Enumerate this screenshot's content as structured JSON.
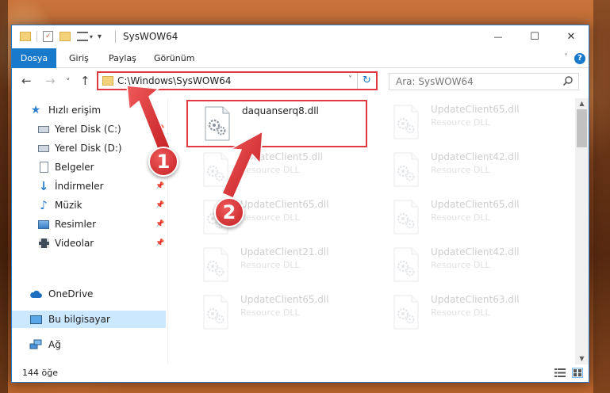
{
  "window": {
    "title": "SysWOW64",
    "minimize_glyph": "—",
    "maximize_glyph": "☐",
    "close_glyph": "✕"
  },
  "ribbon": {
    "tabs": [
      "Dosya",
      "Giriş",
      "Paylaş",
      "Görünüm"
    ],
    "help_glyph": "?"
  },
  "nav": {
    "back_glyph": "←",
    "forward_glyph": "→",
    "recent_glyph": "˅",
    "up_glyph": "↑"
  },
  "address": {
    "path": "C:\\Windows\\SysWOW64"
  },
  "search": {
    "placeholder": "Ara: SysWOW64"
  },
  "sidebar": {
    "items": [
      {
        "label": "Hızlı erişim",
        "icon": "star-icon"
      },
      {
        "label": "Yerel Disk (C:)",
        "icon": "drive-icon",
        "pinned": true
      },
      {
        "label": "Yerel Disk (D:)",
        "icon": "drive-icon",
        "pinned": true
      },
      {
        "label": "Belgeler",
        "icon": "documents-icon",
        "pinned": true
      },
      {
        "label": "İndirmeler",
        "icon": "downloads-icon",
        "pinned": true
      },
      {
        "label": "Müzik",
        "icon": "music-icon",
        "pinned": true
      },
      {
        "label": "Resimler",
        "icon": "pictures-icon",
        "pinned": true
      },
      {
        "label": "Videolar",
        "icon": "videos-icon",
        "pinned": true
      },
      {
        "label": "OneDrive",
        "icon": "cloud-icon"
      },
      {
        "label": "Bu bilgisayar",
        "icon": "computer-icon",
        "selected": true
      },
      {
        "label": "Ağ",
        "icon": "network-icon"
      }
    ]
  },
  "files": [
    {
      "name": "daquanserq8.dll",
      "type": "",
      "highlighted": true
    },
    {
      "name": "UpdateClient65.dll",
      "type": "Resource DLL"
    },
    {
      "name": "UpdateClient5.dll",
      "type": "Resource DLL"
    },
    {
      "name": "UpdateClient42.dll",
      "type": "Resource DLL"
    },
    {
      "name": "UpdateClient65.dll",
      "type": "Resource DLL"
    },
    {
      "name": "UpdateClient65.dll",
      "type": "Resource DLL"
    },
    {
      "name": "UpdateClient21.dll",
      "type": "Resource DLL"
    },
    {
      "name": "UpdateClient42.dll",
      "type": "Resource DLL"
    },
    {
      "name": "UpdateClient65.dll",
      "type": "Resource DLL"
    },
    {
      "name": "UpdateClient63.dll",
      "type": "Resource DLL"
    }
  ],
  "status": {
    "item_count": "144 öğe"
  },
  "annotations": {
    "badge_1": "1",
    "badge_2": "2"
  },
  "colors": {
    "accent": "#1979ca",
    "annotation_red": "#e0393e",
    "selected_bg": "#cce8ff"
  }
}
